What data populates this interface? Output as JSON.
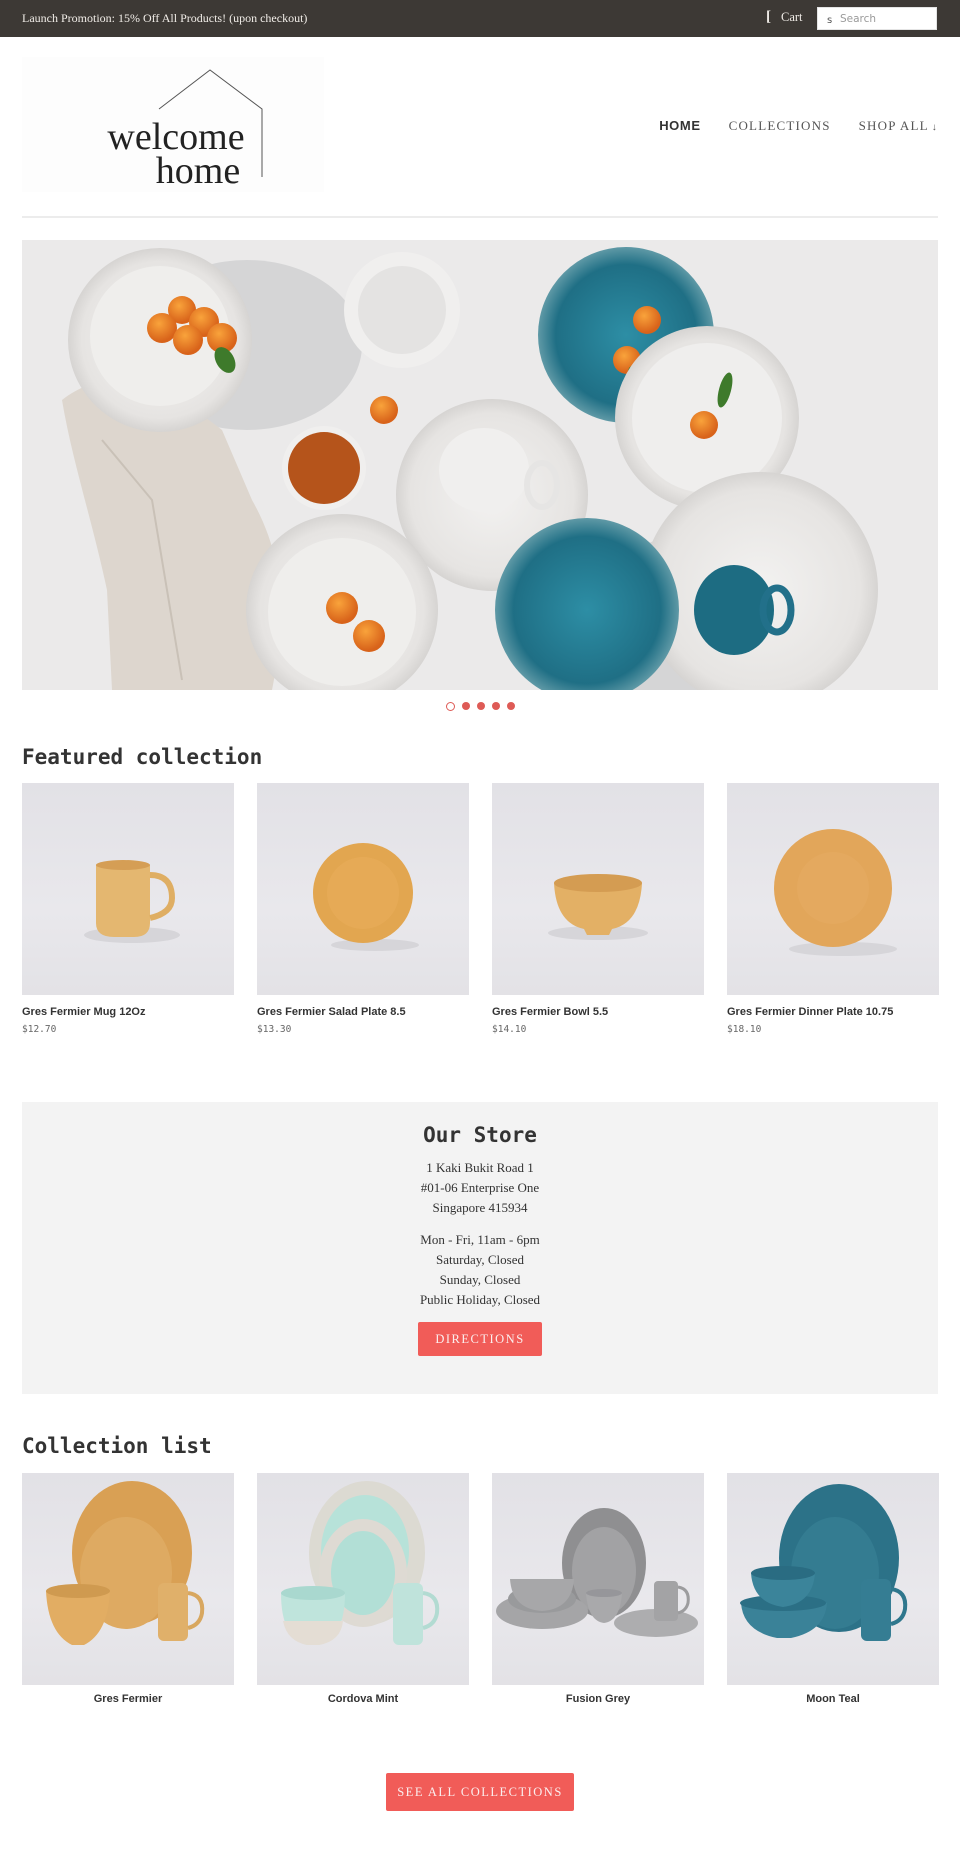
{
  "announcement": {
    "text": "Launch Promotion: 15% Off All Products! (upon checkout)",
    "cart_icon": "[",
    "cart_label": "Cart",
    "search_icon": "s",
    "search_placeholder": "Search",
    "search_value": ""
  },
  "header": {
    "logo_line1": "welcome",
    "logo_line2": "home",
    "nav": [
      {
        "label": "HOME",
        "active": true
      },
      {
        "label": "COLLECTIONS",
        "active": false
      },
      {
        "label": "SHOP ALL",
        "caret": "↓",
        "active": false
      }
    ]
  },
  "hero": {
    "slide_count": 5,
    "active_slide": 1,
    "image_alt": "Tableware arrangement with white and teal plates, bowls, mugs and mandarin oranges on a linen napkin"
  },
  "featured": {
    "title": "Featured collection",
    "products": [
      {
        "name": "Gres Fermier Mug 12Oz",
        "price": "$12.70",
        "image": "mug"
      },
      {
        "name": "Gres Fermier Salad Plate 8.5",
        "price": "$13.30",
        "image": "salad-plate"
      },
      {
        "name": "Gres Fermier Bowl 5.5",
        "price": "$14.10",
        "image": "bowl"
      },
      {
        "name": "Gres Fermier Dinner Plate 10.75",
        "price": "$18.10",
        "image": "dinner-plate"
      }
    ]
  },
  "store": {
    "title": "Our Store",
    "address": [
      "1 Kaki Bukit Road 1",
      "#01-06 Enterprise One",
      "Singapore 415934"
    ],
    "hours": [
      "Mon - Fri, 11am - 6pm",
      "Saturday, Closed",
      "Sunday, Closed",
      "Public Holiday, Closed"
    ],
    "button_label": "DIRECTIONS"
  },
  "collections": {
    "title": "Collection list",
    "items": [
      {
        "name": "Gres Fermier",
        "color": "#dca25c"
      },
      {
        "name": "Cordova Mint",
        "color": "#b7e0d8"
      },
      {
        "name": "Fusion Grey",
        "color": "#9b9b9d"
      },
      {
        "name": "Moon Teal",
        "color": "#2f7c8f"
      }
    ],
    "button_label": "SEE ALL COLLECTIONS"
  },
  "colors": {
    "accent": "#f15c58",
    "topbar": "#3d3935",
    "store_bg": "#f3f3f3"
  }
}
